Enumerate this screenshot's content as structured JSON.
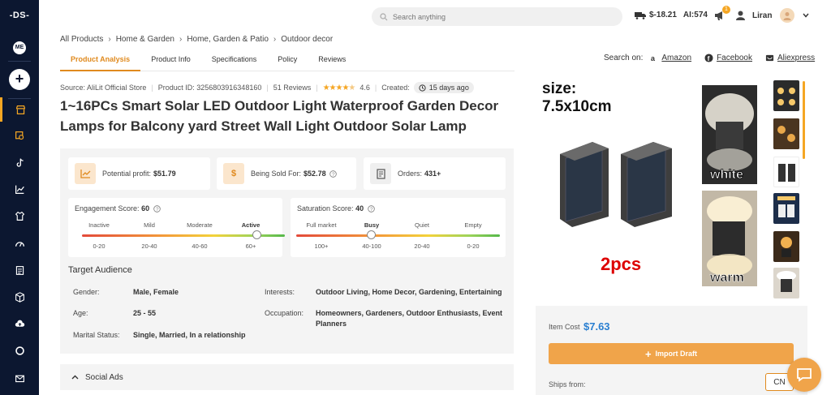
{
  "sidebar": {
    "logo": "-DS-",
    "profile_badge": "ME",
    "add_label": "+",
    "items": [
      {
        "icon": "store-icon",
        "active": true
      },
      {
        "icon": "product-search-icon"
      },
      {
        "icon": "tiktok-icon"
      },
      {
        "icon": "trend-chart-icon"
      },
      {
        "icon": "clothing-icon"
      },
      {
        "icon": "gauge-icon"
      },
      {
        "icon": "document-icon"
      },
      {
        "icon": "package-icon"
      },
      {
        "icon": "cloud-upload-icon"
      },
      {
        "icon": "support-icon"
      },
      {
        "icon": "mail-icon"
      }
    ]
  },
  "header": {
    "search_placeholder": "Search anything",
    "balance": "$-18.21",
    "ai_credits": "AI:574",
    "notification_count": "1",
    "user_name": "Liran"
  },
  "breadcrumb": [
    "All Products",
    "Home & Garden",
    "Home, Garden & Patio",
    "Outdoor decor"
  ],
  "tabs": [
    "Product Analysis",
    "Product Info",
    "Specifications",
    "Policy",
    "Reviews"
  ],
  "active_tab": "Product Analysis",
  "search_on": {
    "label": "Search on:",
    "links": [
      "Amazon",
      "Facebook",
      "Aliexpress"
    ]
  },
  "product": {
    "source": "Source: AliLit Official Store",
    "product_id": "Product ID: 3256803916348160",
    "reviews": "51 Reviews",
    "rating": "4.6",
    "rating_stars": 4.6,
    "created_label": "Created:",
    "created_value": "15 days ago",
    "title": "1~16PCs Smart Solar LED Outdoor Light Waterproof Garden Decor Lamps for Balcony yard Street Wall Light Outdoor Solar Lamp"
  },
  "stats": {
    "profit_label": "Potential profit:",
    "profit_value": "$51.79",
    "sold_label": "Being Sold For:",
    "sold_value": "$52.78",
    "orders_label": "Orders:",
    "orders_value": "431+"
  },
  "engagement": {
    "label": "Engagement Score:",
    "value": "60",
    "levels": [
      "Inactive",
      "Mild",
      "Moderate",
      "Active"
    ],
    "ranges": [
      "0-20",
      "20-40",
      "40-60",
      "60+"
    ],
    "active_level": 3,
    "level_fraction": 0.86
  },
  "saturation": {
    "label": "Saturation Score:",
    "value": "40",
    "levels": [
      "Full market",
      "Busy",
      "Quiet",
      "Empty"
    ],
    "ranges": [
      "100+",
      "40-100",
      "20-40",
      "0-20"
    ],
    "active_level": 1,
    "level_fraction": 0.37
  },
  "audience": {
    "heading": "Target Audience",
    "gender_label": "Gender:",
    "gender": "Male, Female",
    "age_label": "Age:",
    "age": "25 - 55",
    "marital_label": "Marital Status:",
    "marital": "Single, Married, In a relationship",
    "interests_label": "Interests:",
    "interests": "Outdoor Living, Home Decor, Gardening, Entertaining",
    "occupation_label": "Occupation:",
    "occupation_line1": "Homeowners, Gardeners, Outdoor Enthusiasts, Event",
    "occupation_line2": "Planners"
  },
  "social_ads": "Social Ads",
  "gallery": {
    "size_text_1": "size:",
    "size_text_2": "7.5x10cm",
    "pcs_text": "2pcs",
    "white_text": "white",
    "warm_text": "warm"
  },
  "purchase": {
    "item_cost_label": "Item Cost",
    "item_cost_value": "$7.63",
    "import_label": "Import Draft",
    "ships_from_label": "Ships from:",
    "ships_from_value": "CN"
  },
  "colors": {
    "sidebar_bg": "#0c1730",
    "accent": "#e08a1e",
    "price_blue": "#2a7fd1"
  }
}
